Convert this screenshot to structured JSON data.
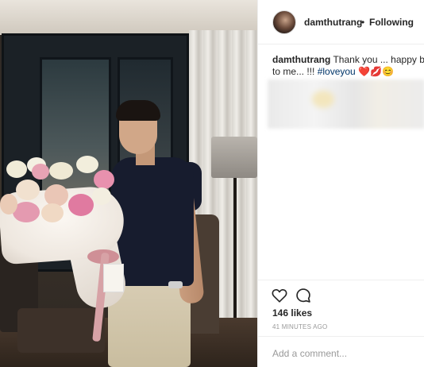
{
  "post": {
    "username": "damthutrang",
    "follow_separator": "•",
    "follow_status": "Following",
    "caption_user": "damthutrang",
    "caption_text": "Thank you ... happy birt",
    "caption_line2_text": "to me... !!! ",
    "hashtag": "#loveyou",
    "emojis": "❤️💋😊",
    "likes": "146 likes",
    "timestamp": "41 MINUTES AGO",
    "comment_placeholder": "Add a comment..."
  },
  "icons": {
    "like": "heart-outline-icon",
    "comment": "comment-bubble-icon"
  },
  "colors": {
    "text": "#262626",
    "hashtag": "#003569",
    "muted": "#999999",
    "border": "#efefef"
  }
}
